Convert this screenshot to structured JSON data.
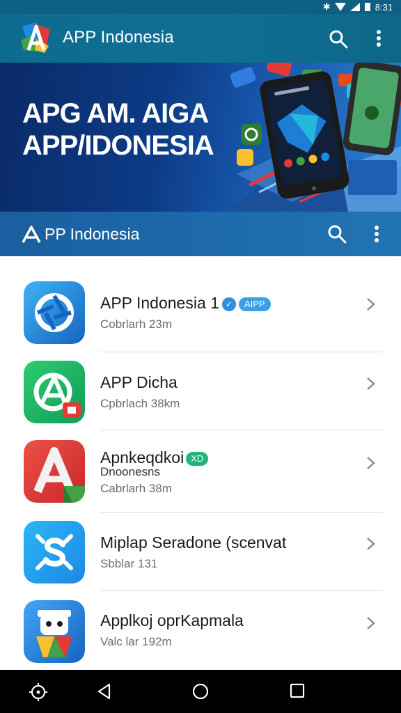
{
  "status_bar": {
    "time": "8:31"
  },
  "appbar": {
    "title": "APP Indonesia"
  },
  "banner": {
    "headline_line1": "APG AM. AIGA",
    "headline_line2": "APP/IDONESIA"
  },
  "toolbar2": {
    "title": "PP Indonesia"
  },
  "list": {
    "items": [
      {
        "name": "APP Indonesia",
        "name_suffix": "1",
        "badge_circle": "",
        "badge_pill": "AIPP",
        "subtitle": "Cobrlarh 23m"
      },
      {
        "name": "APP Dicha",
        "subtitle": "Cpbrlach 38km"
      },
      {
        "name": "Apnkeqdkoi",
        "badge_green": "XD",
        "subtitle2": "Dnoonesns",
        "subtitle": "Cabrlarh 38m"
      },
      {
        "name": "Miplap Seradone (scenvat",
        "subtitle": "Sbblar 131"
      },
      {
        "name": "Applkoj oprKapmala",
        "subtitle": "Valc lar 192m"
      }
    ]
  },
  "colors": {
    "appbar": "#0e6b90",
    "toolbar2": "#1e6aaa",
    "accent_blue": "#3aa0e8",
    "accent_green": "#22b47a",
    "navbar": "#000000"
  },
  "icons": {
    "appbar_logo": "app-logo-icon",
    "search": "search-icon",
    "more": "more-vert-icon",
    "chevron": "chevron-right-icon",
    "nav": [
      "assist-icon",
      "back-icon",
      "home-icon",
      "recents-icon"
    ]
  }
}
